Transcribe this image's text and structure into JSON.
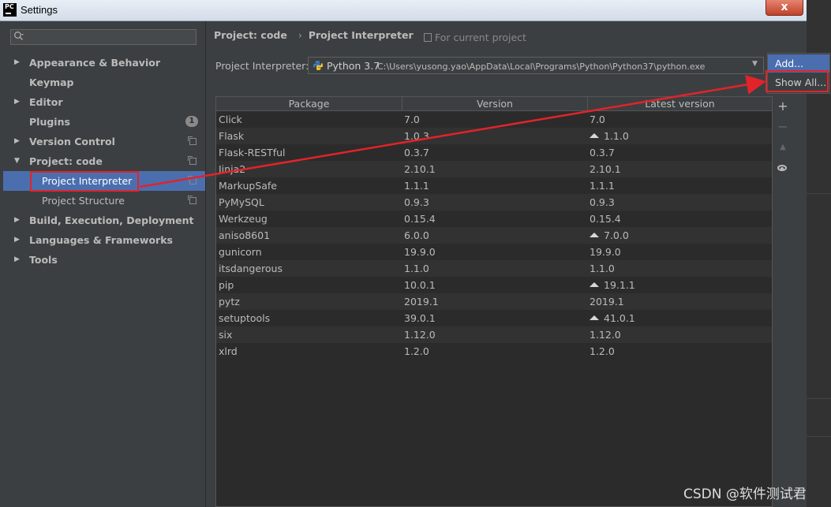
{
  "window": {
    "title": "Settings",
    "app_icon": "PC",
    "close_label": "x"
  },
  "sidebar": {
    "search_placeholder": "",
    "items": [
      {
        "label": "Appearance & Behavior",
        "expandable": true,
        "expanded": false,
        "bold": true
      },
      {
        "label": "Keymap",
        "expandable": false,
        "bold": true
      },
      {
        "label": "Editor",
        "expandable": true,
        "expanded": false,
        "bold": true
      },
      {
        "label": "Plugins",
        "expandable": false,
        "bold": true,
        "badge": "1"
      },
      {
        "label": "Version Control",
        "expandable": true,
        "expanded": false,
        "bold": true,
        "copy_icon": true
      },
      {
        "label": "Project: code",
        "expandable": true,
        "expanded": true,
        "bold": true,
        "copy_icon": true
      },
      {
        "label": "Project Interpreter",
        "child": true,
        "selected": true,
        "copy_icon": true
      },
      {
        "label": "Project Structure",
        "child": true,
        "copy_icon": true
      },
      {
        "label": "Build, Execution, Deployment",
        "expandable": true,
        "expanded": false,
        "bold": true
      },
      {
        "label": "Languages & Frameworks",
        "expandable": true,
        "expanded": false,
        "bold": true
      },
      {
        "label": "Tools",
        "expandable": true,
        "expanded": false,
        "bold": true
      }
    ]
  },
  "content": {
    "breadcrumb": [
      "Project: code",
      "Project Interpreter"
    ],
    "breadcrumb_sep": "›",
    "for_current_project": "For current project",
    "interpreter_label": "Project Interpreter:",
    "interpreter_name": "Python 3.7",
    "interpreter_path": "C:\\Users\\yusong.yao\\AppData\\Local\\Programs\\Python\\Python37\\python.exe",
    "gear_menu": [
      {
        "label": "Add...",
        "active": true
      },
      {
        "label": "Show All...",
        "active": false,
        "highlighted": true
      }
    ],
    "table": {
      "columns": [
        "Package",
        "Version",
        "Latest version"
      ],
      "rows": [
        {
          "package": "Click",
          "version": "7.0",
          "latest": "7.0",
          "upgrade": false
        },
        {
          "package": "Flask",
          "version": "1.0.3",
          "latest": "1.1.0",
          "upgrade": true
        },
        {
          "package": "Flask-RESTful",
          "version": "0.3.7",
          "latest": "0.3.7",
          "upgrade": false
        },
        {
          "package": "Jinja2",
          "version": "2.10.1",
          "latest": "2.10.1",
          "upgrade": false
        },
        {
          "package": "MarkupSafe",
          "version": "1.1.1",
          "latest": "1.1.1",
          "upgrade": false
        },
        {
          "package": "PyMySQL",
          "version": "0.9.3",
          "latest": "0.9.3",
          "upgrade": false
        },
        {
          "package": "Werkzeug",
          "version": "0.15.4",
          "latest": "0.15.4",
          "upgrade": false
        },
        {
          "package": "aniso8601",
          "version": "6.0.0",
          "latest": "7.0.0",
          "upgrade": true
        },
        {
          "package": "gunicorn",
          "version": "19.9.0",
          "latest": "19.9.0",
          "upgrade": false
        },
        {
          "package": "itsdangerous",
          "version": "1.1.0",
          "latest": "1.1.0",
          "upgrade": false
        },
        {
          "package": "pip",
          "version": "10.0.1",
          "latest": "19.1.1",
          "upgrade": true
        },
        {
          "package": "pytz",
          "version": "2019.1",
          "latest": "2019.1",
          "upgrade": false
        },
        {
          "package": "setuptools",
          "version": "39.0.1",
          "latest": "41.0.1",
          "upgrade": true
        },
        {
          "package": "six",
          "version": "1.12.0",
          "latest": "1.12.0",
          "upgrade": false
        },
        {
          "package": "xlrd",
          "version": "1.2.0",
          "latest": "1.2.0",
          "upgrade": false
        }
      ]
    },
    "tools": [
      {
        "icon": "add-icon",
        "glyph": "+",
        "enabled": true
      },
      {
        "icon": "remove-icon",
        "glyph": "−",
        "enabled": false
      },
      {
        "icon": "upgrade-icon",
        "glyph": "▲",
        "enabled": false
      },
      {
        "icon": "eye-icon",
        "glyph": "",
        "enabled": true
      }
    ]
  },
  "watermark": "CSDN @软件测试君",
  "colors": {
    "selection": "#4b6eaf",
    "annotation": "#e2232a",
    "background": "#3c3f41"
  }
}
